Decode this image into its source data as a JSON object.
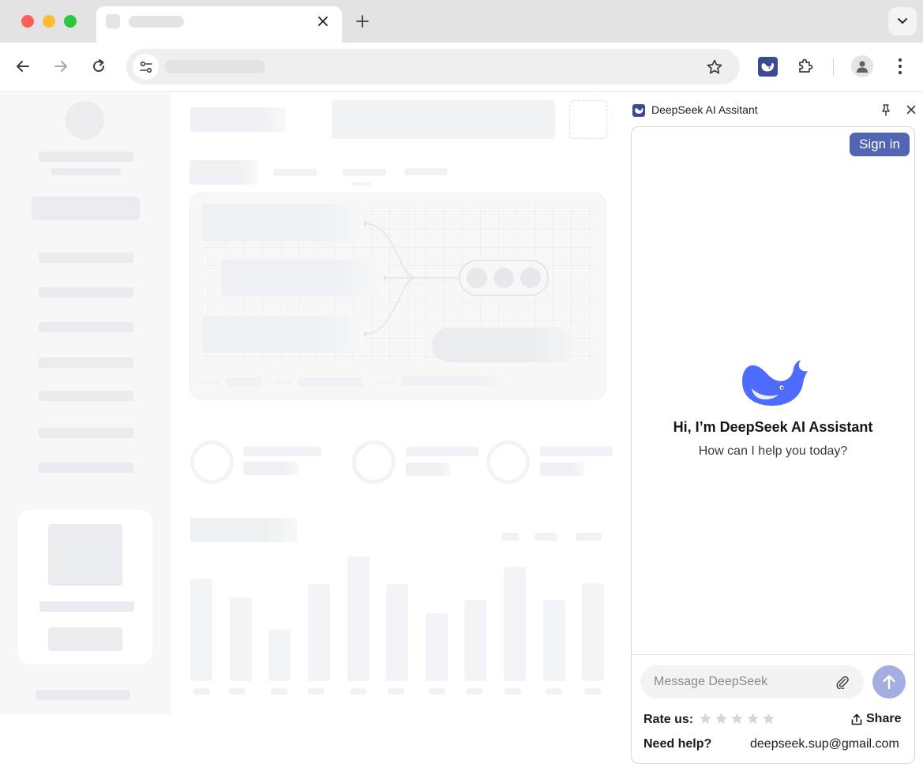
{
  "browser": {
    "tab": {
      "title": ""
    },
    "omnibox": {
      "url": ""
    }
  },
  "panel": {
    "title": "DeepSeek AI Assitant",
    "sign_in_label": "Sign in",
    "greeting_title": "Hi, I’m DeepSeek AI Assistant",
    "greeting_subtitle": "How can I help you today?",
    "message_placeholder": "Message DeepSeek",
    "rate_label": "Rate us:",
    "rating_max": 5,
    "rating_value": 0,
    "share_label": "Share",
    "help_label": "Need help?",
    "help_email": "deepseek.sup@gmail.com"
  },
  "colors": {
    "brand": "#3c4a8f",
    "sign_in": "#5165b2",
    "send_disabled": "#a4aee0",
    "whale": "#4d6bfe"
  },
  "icons": {
    "toolbar": [
      "back-icon",
      "forward-icon",
      "reload-icon",
      "site-info-icon",
      "bookmark-star-icon",
      "deepseek-extension-icon",
      "extensions-puzzle-icon",
      "profile-icon",
      "more-menu-icon"
    ],
    "panel": [
      "deepseek-logo-icon",
      "pin-icon",
      "close-icon",
      "whale-logo-icon",
      "attach-icon",
      "send-arrow-icon",
      "star-icon",
      "share-icon"
    ]
  }
}
